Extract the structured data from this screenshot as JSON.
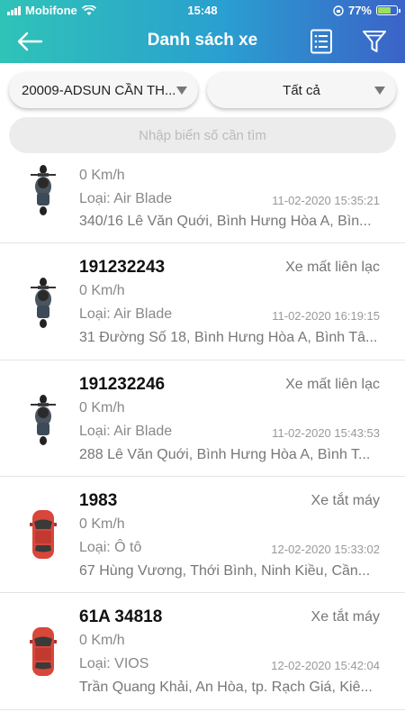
{
  "status_bar": {
    "carrier": "Mobifone",
    "time": "15:48",
    "battery": "77%"
  },
  "header": {
    "title": "Danh sách xe",
    "back_icon": "arrow-left-icon",
    "list_icon": "list-icon",
    "filter_icon": "funnel-icon"
  },
  "filters": {
    "company": "20009-ADSUN CẦN TH...",
    "status": "Tất cả",
    "search_placeholder": "Nhập biển số cần tìm"
  },
  "vehicles": [
    {
      "icon": "motorbike-icon",
      "plate": "",
      "status": "",
      "speed": "0 Km/h",
      "type": "Loại: Air Blade",
      "datetime": "11-02-2020 15:35:21",
      "address": "340/16 Lê Văn Quới, Bình Hưng Hòa A, Bìn..."
    },
    {
      "icon": "motorbike-icon",
      "plate": "191232243",
      "status": "Xe mất liên lạc",
      "speed": "0 Km/h",
      "type": "Loại: Air Blade",
      "datetime": "11-02-2020 16:19:15",
      "address": "31 Đường Số 18, Bình Hưng Hòa A, Bình Tâ..."
    },
    {
      "icon": "motorbike-icon",
      "plate": "191232246",
      "status": "Xe mất liên lạc",
      "speed": "0 Km/h",
      "type": "Loại: Air Blade",
      "datetime": "11-02-2020 15:43:53",
      "address": "288 Lê Văn Quới, Bình Hưng Hòa A, Bình T..."
    },
    {
      "icon": "car-icon",
      "plate": "1983",
      "status": "Xe tắt máy",
      "speed": "0 Km/h",
      "type": "Loại: Ô tô",
      "datetime": "12-02-2020 15:33:02",
      "address": "67 Hùng Vương, Thới Bình, Ninh Kiều, Cần..."
    },
    {
      "icon": "car-icon",
      "plate": "61A 34818",
      "status": "Xe tắt máy",
      "speed": "0 Km/h",
      "type": "Loại: VIOS",
      "datetime": "12-02-2020 15:42:04",
      "address": "Trần Quang Khải, An Hòa, tp. Rạch Giá, Kiê..."
    }
  ],
  "colors": {
    "header_start": "#2fc3b7",
    "header_end": "#3b63c8",
    "car_red": "#d9463a"
  }
}
